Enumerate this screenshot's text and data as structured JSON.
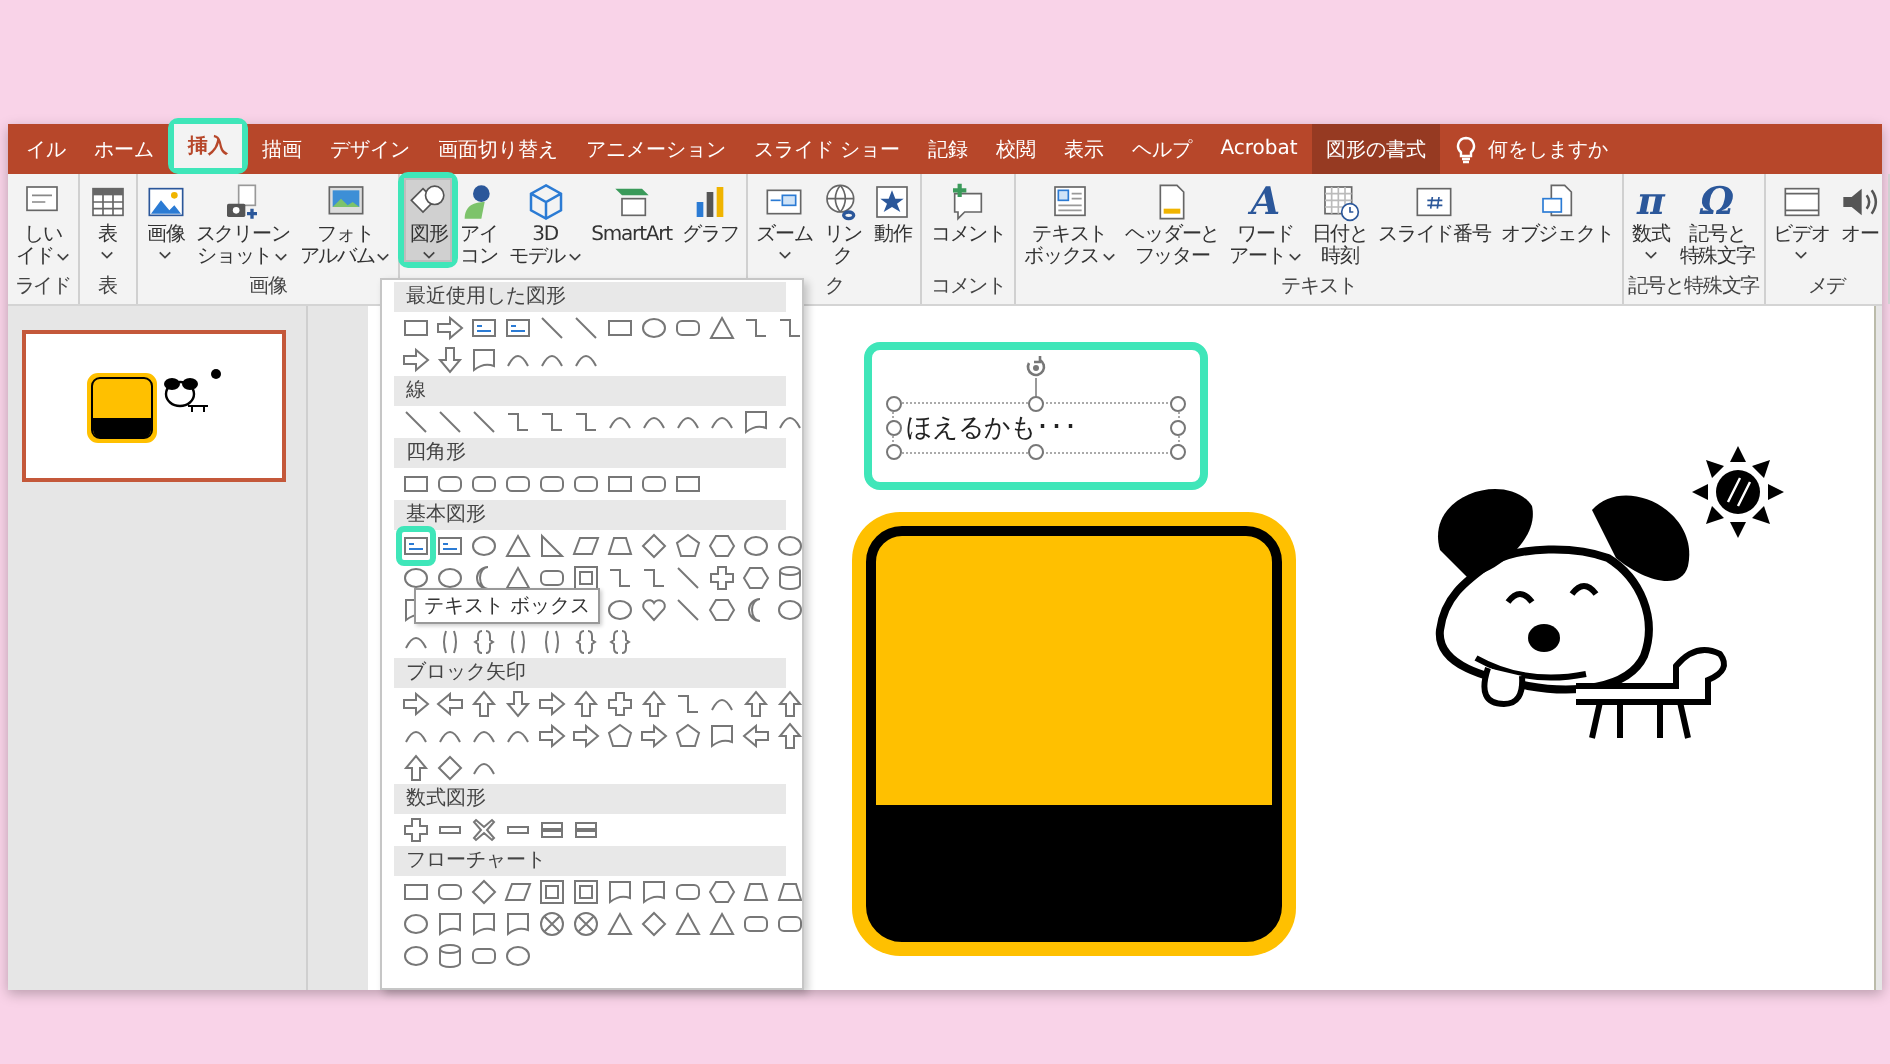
{
  "tabs": [
    {
      "label": "イル",
      "selected": false,
      "contextual": false,
      "highlighted": false
    },
    {
      "label": "ホーム",
      "selected": false,
      "contextual": false,
      "highlighted": false
    },
    {
      "label": "挿入",
      "selected": true,
      "contextual": false,
      "highlighted": true
    },
    {
      "label": "描画",
      "selected": false,
      "contextual": false,
      "highlighted": false
    },
    {
      "label": "デザイン",
      "selected": false,
      "contextual": false,
      "highlighted": false
    },
    {
      "label": "画面切り替え",
      "selected": false,
      "contextual": false,
      "highlighted": false
    },
    {
      "label": "アニメーション",
      "selected": false,
      "contextual": false,
      "highlighted": false
    },
    {
      "label": "スライド ショー",
      "selected": false,
      "contextual": false,
      "highlighted": false
    },
    {
      "label": "記録",
      "selected": false,
      "contextual": false,
      "highlighted": false
    },
    {
      "label": "校閲",
      "selected": false,
      "contextual": false,
      "highlighted": false
    },
    {
      "label": "表示",
      "selected": false,
      "contextual": false,
      "highlighted": false
    },
    {
      "label": "ヘルプ",
      "selected": false,
      "contextual": false,
      "highlighted": false
    },
    {
      "label": "Acrobat",
      "selected": false,
      "contextual": false,
      "highlighted": false
    },
    {
      "label": "図形の書式",
      "selected": false,
      "contextual": true,
      "highlighted": false
    }
  ],
  "tell_me": {
    "label": "何をしますか"
  },
  "ribbon": {
    "groups": [
      {
        "label": "ライド",
        "items": [
          {
            "lines": [
              "しい",
              "イド"
            ],
            "menu": true,
            "selected": false,
            "highlighted": false
          }
        ]
      },
      {
        "label": "表",
        "items": [
          {
            "lines": [
              "表"
            ],
            "menu": true,
            "selected": false,
            "highlighted": false
          }
        ]
      },
      {
        "label": "画像",
        "items": [
          {
            "lines": [
              "画像"
            ],
            "menu": true,
            "selected": false,
            "highlighted": false
          },
          {
            "lines": [
              "スクリーン",
              "ショット"
            ],
            "menu": true,
            "selected": false,
            "highlighted": false
          },
          {
            "lines": [
              "フォト",
              "アルバム"
            ],
            "menu": true,
            "selected": false,
            "highlighted": false
          }
        ]
      },
      {
        "items": [
          {
            "lines": [
              "図形"
            ],
            "menu": true,
            "selected": true,
            "highlighted": true
          },
          {
            "lines": [
              "アイ",
              "コン"
            ],
            "menu": false,
            "selected": false,
            "highlighted": false
          },
          {
            "lines": [
              "3D",
              "モデル"
            ],
            "menu": true,
            "selected": false,
            "highlighted": false
          },
          {
            "lines": [
              "SmartArt"
            ],
            "menu": false,
            "selected": false,
            "highlighted": false
          },
          {
            "lines": [
              "グラフ"
            ],
            "menu": false,
            "selected": false,
            "highlighted": false
          }
        ]
      },
      {
        "label": "ク",
        "items": [
          {
            "lines": [
              "ズーム"
            ],
            "menu": true,
            "selected": false,
            "highlighted": false
          },
          {
            "lines": [
              "リン",
              "ク"
            ],
            "menu": false,
            "selected": false,
            "highlighted": false
          },
          {
            "lines": [
              "動作"
            ],
            "menu": false,
            "selected": false,
            "highlighted": false
          }
        ]
      },
      {
        "label": "コメント",
        "items": [
          {
            "lines": [
              "コメント"
            ],
            "menu": false,
            "selected": false,
            "highlighted": false
          }
        ]
      },
      {
        "label": "テキスト",
        "items": [
          {
            "lines": [
              "テキスト",
              "ボックス"
            ],
            "menu": true,
            "selected": false,
            "highlighted": false
          },
          {
            "lines": [
              "ヘッダーと",
              "フッター"
            ],
            "menu": false,
            "selected": false,
            "highlighted": false
          },
          {
            "lines": [
              "ワード",
              "アート"
            ],
            "menu": true,
            "selected": false,
            "highlighted": false,
            "glyph": "A"
          },
          {
            "lines": [
              "日付と",
              "時刻"
            ],
            "menu": false,
            "selected": false,
            "highlighted": false
          },
          {
            "lines": [
              "スライド番号"
            ],
            "menu": false,
            "selected": false,
            "highlighted": false
          },
          {
            "lines": [
              "オブジェクト"
            ],
            "menu": false,
            "selected": false,
            "highlighted": false
          }
        ]
      },
      {
        "label": "記号と特殊文字",
        "items": [
          {
            "lines": [
              "数式"
            ],
            "menu": true,
            "selected": false,
            "highlighted": false,
            "glyph": "π"
          },
          {
            "lines": [
              "記号と",
              "特殊文字"
            ],
            "menu": false,
            "selected": false,
            "highlighted": false,
            "glyph": "Ω"
          }
        ]
      },
      {
        "label": "メデ",
        "items": [
          {
            "lines": [
              "ビデオ"
            ],
            "menu": true,
            "selected": false,
            "highlighted": false
          },
          {
            "lines": [
              "オー"
            ],
            "menu": false,
            "selected": false,
            "highlighted": false
          }
        ]
      }
    ]
  },
  "thumbnail": {
    "selected": true
  },
  "shape_gallery": {
    "sections": [
      {
        "title": "最近使用した図形"
      },
      {
        "title": "線"
      },
      {
        "title": "四角形"
      },
      {
        "title": "基本図形",
        "tooltip": {
          "text": "テキスト ボックス",
          "highlighted": true
        }
      },
      {
        "title": "ブロック矢印"
      },
      {
        "title": "数式図形"
      },
      {
        "title": "フローチャート"
      }
    ]
  },
  "slide": {
    "text_box": {
      "text": "ほえるかも･･･",
      "selected": true,
      "highlighted": true
    }
  }
}
